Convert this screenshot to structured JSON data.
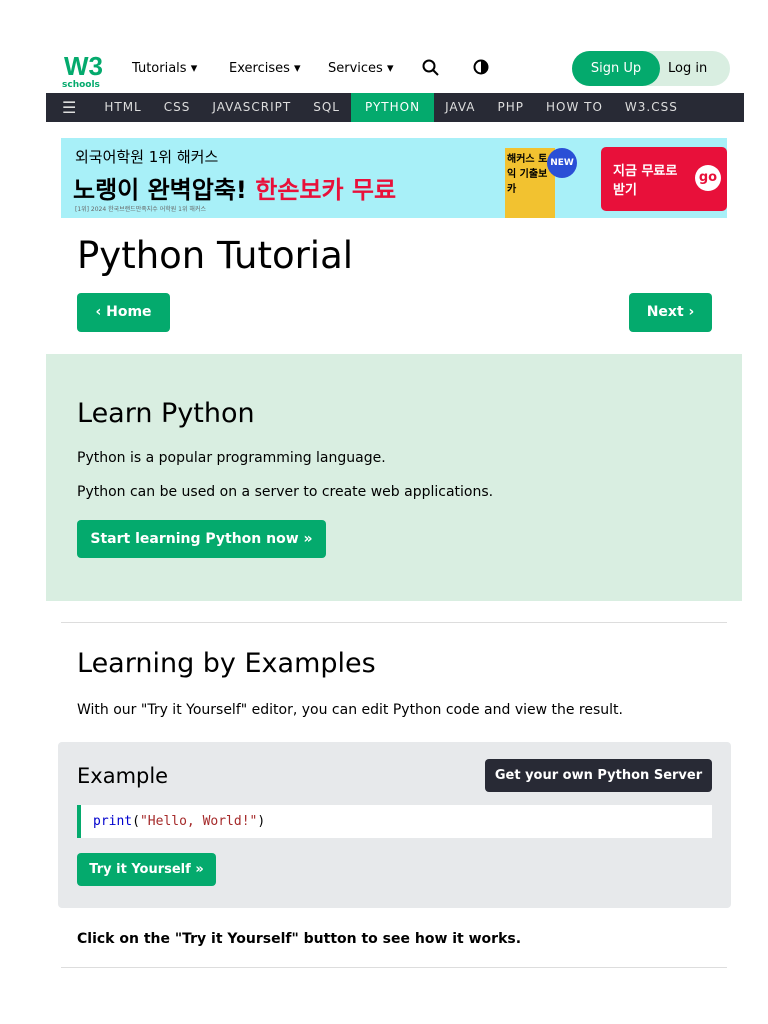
{
  "header": {
    "logo_text": "W3",
    "logo_sub": "schools",
    "menus": [
      "Tutorials",
      "Exercises",
      "Services"
    ],
    "signup": "Sign Up",
    "login": "Log in"
  },
  "nav": {
    "items": [
      "HTML",
      "CSS",
      "JAVASCRIPT",
      "SQL",
      "PYTHON",
      "JAVA",
      "PHP",
      "HOW TO",
      "W3.CSS"
    ],
    "active": "PYTHON"
  },
  "ad": {
    "line1": "외국어학원 1위 해커스",
    "line2a": "노랭이 완벽압축!",
    "line2b": "한손보카 무료",
    "small": "[1위] 2024 한국브랜드만족지수 어학원 1위 해커스",
    "badge": "NEW",
    "book": "해커스 토익 기출보카",
    "cta": "지금 무료로 받기",
    "go": "go"
  },
  "page": {
    "title": "Python Tutorial",
    "home": "Home",
    "next": "Next"
  },
  "learn": {
    "title": "Learn Python",
    "p1": "Python is a popular programming language.",
    "p2": "Python can be used on a server to create web applications.",
    "button": "Start learning Python now »"
  },
  "examples": {
    "title": "Learning by Examples",
    "text": "With our \"Try it Yourself\" editor, you can edit Python code and view the result.",
    "box_title": "Example",
    "server_button": "Get your own Python Server",
    "code_fn": "print",
    "code_str": "\"Hello, World!\"",
    "try_button": "Try it Yourself »",
    "footer": "Click on the \"Try it Yourself\" button to see how it works."
  }
}
